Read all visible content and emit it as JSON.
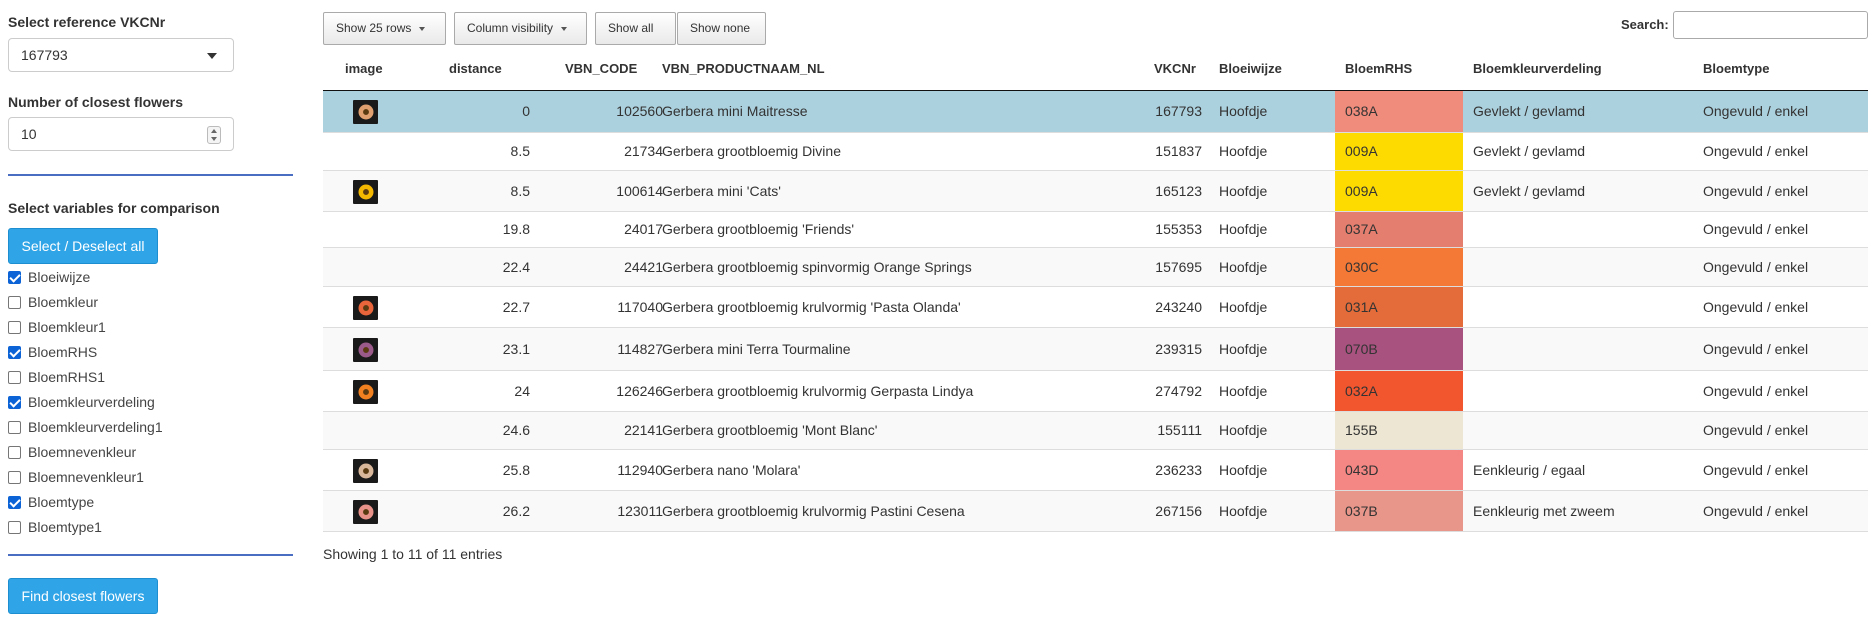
{
  "sidebar": {
    "ref_label": "Select reference VKCNr",
    "ref_value": "167793",
    "num_label": "Number of closest flowers",
    "num_value": "10",
    "vars_label": "Select variables for comparison",
    "select_all_label": "Select / Deselect all",
    "checkboxes": [
      {
        "label": "Bloeiwijze",
        "checked": true
      },
      {
        "label": "Bloemkleur",
        "checked": false
      },
      {
        "label": "Bloemkleur1",
        "checked": false
      },
      {
        "label": "BloemRHS",
        "checked": true
      },
      {
        "label": "BloemRHS1",
        "checked": false
      },
      {
        "label": "Bloemkleurverdeling",
        "checked": true
      },
      {
        "label": "Bloemkleurverdeling1",
        "checked": false
      },
      {
        "label": "Bloemnevenkleur",
        "checked": false
      },
      {
        "label": "Bloemnevenkleur1",
        "checked": false
      },
      {
        "label": "Bloemtype",
        "checked": true
      },
      {
        "label": "Bloemtype1",
        "checked": false
      }
    ],
    "find_label": "Find closest flowers",
    "accent_color": "#2fa4e7"
  },
  "toolbar": {
    "show_rows_label": "Show 25 rows",
    "col_vis_label": "Column visibility",
    "show_all_label": "Show all",
    "show_none_label": "Show none",
    "search_label": "Search:",
    "search_value": ""
  },
  "table": {
    "headers": {
      "image": "image",
      "distance": "distance",
      "code": "VBN_CODE",
      "name": "VBN_PRODUCTNAAM_NL",
      "vkc": "VKCNr",
      "bloeiwijze": "Bloeiwijze",
      "rhs": "BloemRHS",
      "verdeling": "Bloemkleurverdeling",
      "type": "Bloemtype"
    },
    "rows": [
      {
        "img": "flower-thumbnail-peach",
        "distance": "0",
        "code": "102560",
        "name": "Gerbera mini Maitresse",
        "vkc": "167793",
        "bloeiwijze": "Hoofdje",
        "rhs": "038A",
        "rhs_color": "#f08c7c",
        "verdeling": "Gevlekt / gevlamd",
        "type": "Ongevuld / enkel"
      },
      {
        "img": "",
        "distance": "8.5",
        "code": "21734",
        "name": "Gerbera grootbloemig Divine",
        "vkc": "151837",
        "bloeiwijze": "Hoofdje",
        "rhs": "009A",
        "rhs_color": "#fedb00",
        "verdeling": "Gevlekt / gevlamd",
        "type": "Ongevuld / enkel"
      },
      {
        "img": "flower-thumbnail-yellow",
        "distance": "8.5",
        "code": "100614",
        "name": "Gerbera mini 'Cats'",
        "vkc": "165123",
        "bloeiwijze": "Hoofdje",
        "rhs": "009A",
        "rhs_color": "#fedb00",
        "verdeling": "Gevlekt / gevlamd",
        "type": "Ongevuld / enkel"
      },
      {
        "img": "",
        "distance": "19.8",
        "code": "24017",
        "name": "Gerbera grootbloemig 'Friends'",
        "vkc": "155353",
        "bloeiwijze": "Hoofdje",
        "rhs": "037A",
        "rhs_color": "#e47f6f",
        "verdeling": "",
        "type": "Ongevuld / enkel"
      },
      {
        "img": "",
        "distance": "22.4",
        "code": "24421",
        "name": "Gerbera grootbloemig spinvormig Orange Springs",
        "vkc": "157695",
        "bloeiwijze": "Hoofdje",
        "rhs": "030C",
        "rhs_color": "#f47836",
        "verdeling": "",
        "type": "Ongevuld / enkel"
      },
      {
        "img": "flower-thumbnail-orange",
        "distance": "22.7",
        "code": "117040",
        "name": "Gerbera grootbloemig krulvormig 'Pasta Olanda'",
        "vkc": "243240",
        "bloeiwijze": "Hoofdje",
        "rhs": "031A",
        "rhs_color": "#e36c3a",
        "verdeling": "",
        "type": "Ongevuld / enkel"
      },
      {
        "img": "flower-thumbnail-purple",
        "distance": "23.1",
        "code": "114827",
        "name": "Gerbera mini Terra Tourmaline",
        "vkc": "239315",
        "bloeiwijze": "Hoofdje",
        "rhs": "070B",
        "rhs_color": "#a8537f",
        "verdeling": "",
        "type": "Ongevuld / enkel"
      },
      {
        "img": "flower-thumbnail-orange-spiky",
        "distance": "24",
        "code": "126246",
        "name": "Gerbera grootbloemig krulvormig Gerpasta Lindya",
        "vkc": "274792",
        "bloeiwijze": "Hoofdje",
        "rhs": "032A",
        "rhs_color": "#f2562f",
        "verdeling": "",
        "type": "Ongevuld / enkel"
      },
      {
        "img": "",
        "distance": "24.6",
        "code": "22141",
        "name": "Gerbera grootbloemig 'Mont Blanc'",
        "vkc": "155111",
        "bloeiwijze": "Hoofdje",
        "rhs": "155B",
        "rhs_color": "#ede6d2",
        "verdeling": "",
        "type": "Ongevuld / enkel"
      },
      {
        "img": "flower-thumbnail-pale",
        "distance": "25.8",
        "code": "112940",
        "name": "Gerbera nano 'Molara'",
        "vkc": "236233",
        "bloeiwijze": "Hoofdje",
        "rhs": "043D",
        "rhs_color": "#f48683",
        "verdeling": "Eenkleurig / egaal",
        "type": "Ongevuld / enkel"
      },
      {
        "img": "flower-thumbnail-salmon",
        "distance": "26.2",
        "code": "123011",
        "name": "Gerbera grootbloemig krulvormig Pastini Cesena",
        "vkc": "267156",
        "bloeiwijze": "Hoofdje",
        "rhs": "037B",
        "rhs_color": "#e8968a",
        "verdeling": "Eenkleurig met zweem",
        "type": "Ongevuld / enkel"
      }
    ],
    "selected_row_color": "#acd1de"
  },
  "info": "Showing 1 to 11 of 11 entries"
}
